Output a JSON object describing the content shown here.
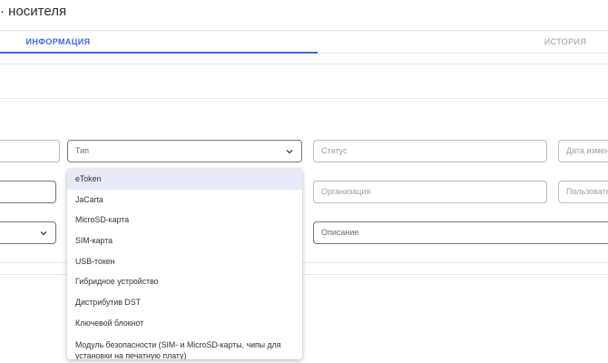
{
  "header": {
    "title": "· носителя"
  },
  "tabs": [
    {
      "label": "ИНФОРМАЦИЯ",
      "active": true
    },
    {
      "label": "ИСТОРИЯ",
      "active": false
    }
  ],
  "form": {
    "type_placeholder": "Тип",
    "status_placeholder": "Статус",
    "date_changed_placeholder": "Дата измен",
    "organization_placeholder": "Организация",
    "user_placeholder": "Пользовате",
    "description_placeholder": "Описание"
  },
  "dropdown": {
    "selected_index": 0,
    "options": [
      "eToken",
      "JaCarta",
      "MicroSD-карта",
      "SIM-карта",
      "USB-токен",
      "Гибридное устройство",
      "Дистрибутив DST",
      "Ключевой блокнот",
      "Модуль безопасности (SIM- и MicroSD-карты, чипы для установки на печатную плату)"
    ]
  },
  "colors": {
    "accent": "#3f6ad8",
    "selected_bg": "#e6eaf9"
  },
  "icons": {
    "select_arrow": "chevron-down-icon"
  }
}
